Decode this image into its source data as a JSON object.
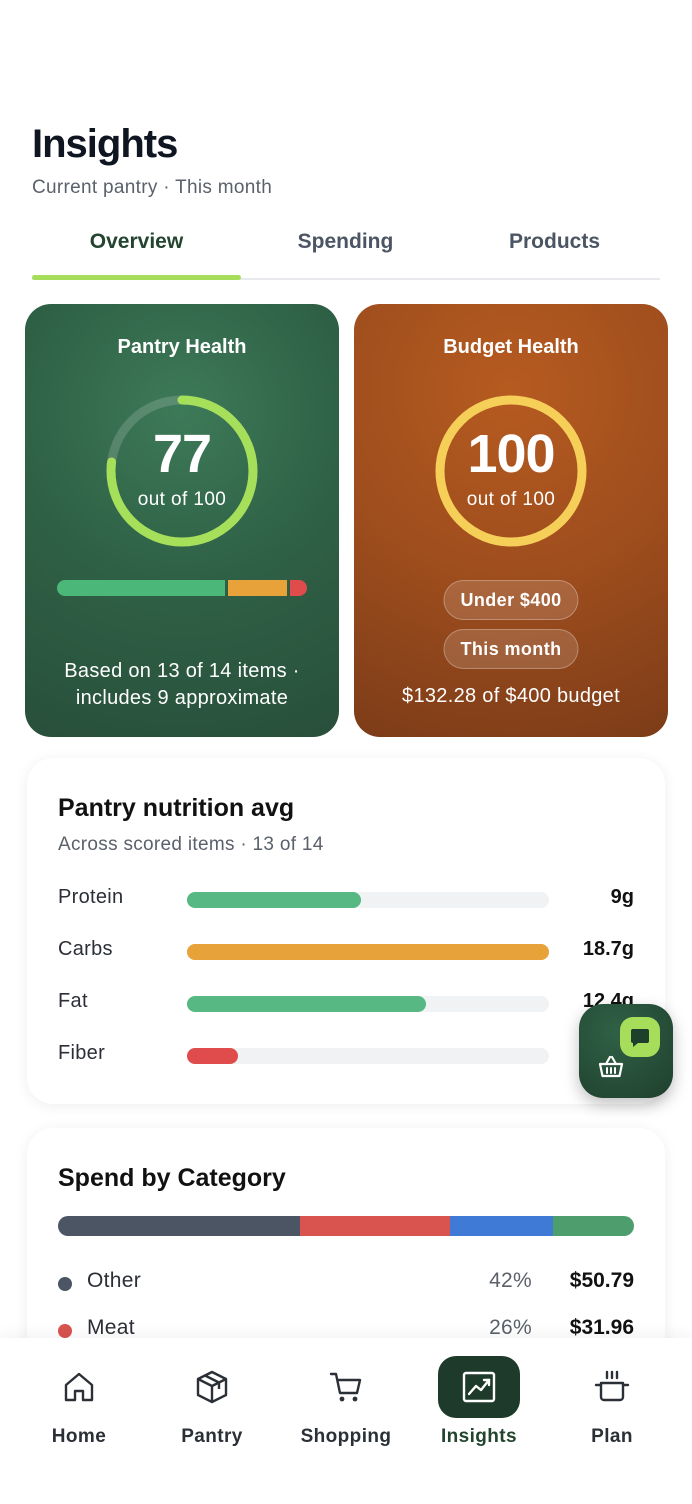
{
  "header": {
    "title": "Insights",
    "subtitle": "Current pantry · This month"
  },
  "tabs": [
    {
      "label": "Overview",
      "active": true
    },
    {
      "label": "Spending",
      "active": false
    },
    {
      "label": "Products",
      "active": false
    }
  ],
  "pantry_health": {
    "title": "Pantry Health",
    "score": "77",
    "score_max_label": "out of 100",
    "score_fraction": 0.77,
    "ring_color": "#a6e05a",
    "segments": [
      {
        "fraction": 0.69,
        "color": "#4bb879"
      },
      {
        "fraction": 0.24,
        "color": "#e8a23a"
      },
      {
        "fraction": 0.07,
        "color": "#e04b4b"
      }
    ],
    "footer_line1": "Based on 13 of 14 items ·",
    "footer_line2": "includes 9 approximate"
  },
  "budget_health": {
    "title": "Budget Health",
    "score": "100",
    "score_max_label": "out of 100",
    "score_fraction": 1.0,
    "ring_color": "#f6cf58",
    "pill_limit": "Under $400",
    "pill_period": "This month",
    "footer": "$132.28 of $400 budget"
  },
  "nutrition": {
    "title": "Pantry nutrition avg",
    "subtitle": "Across scored items · 13 of 14",
    "rows": [
      {
        "label": "Protein",
        "value": "9g",
        "fraction": 0.48,
        "color": "#57b884"
      },
      {
        "label": "Carbs",
        "value": "18.7g",
        "fraction": 1.0,
        "color": "#e8a23a"
      },
      {
        "label": "Fat",
        "value": "12.4g",
        "fraction": 0.66,
        "color": "#57b884"
      },
      {
        "label": "Fiber",
        "value": "",
        "fraction": 0.14,
        "color": "#e04b4b"
      }
    ]
  },
  "spend": {
    "title": "Spend by Category",
    "segments": [
      {
        "fraction": 0.42,
        "color": "#4b5563"
      },
      {
        "fraction": 0.26,
        "color": "#d9534f"
      },
      {
        "fraction": 0.18,
        "color": "#3f7bd6"
      },
      {
        "fraction": 0.14,
        "color": "#4d9e6c"
      }
    ],
    "rows": [
      {
        "name": "Other",
        "pct": "42%",
        "amount": "$50.79",
        "color": "#4b5563"
      },
      {
        "name": "Meat",
        "pct": "26%",
        "amount": "$31.96",
        "color": "#d9534f"
      }
    ]
  },
  "fab": {
    "icon": "basket-icon",
    "badge_icon": "chat-icon"
  },
  "nav": [
    {
      "label": "Home",
      "icon": "home-icon",
      "active": false
    },
    {
      "label": "Pantry",
      "icon": "box-icon",
      "active": false
    },
    {
      "label": "Shopping",
      "icon": "cart-icon",
      "active": false
    },
    {
      "label": "Insights",
      "icon": "chart-icon",
      "active": true
    },
    {
      "label": "Plan",
      "icon": "pot-icon",
      "active": false
    }
  ]
}
